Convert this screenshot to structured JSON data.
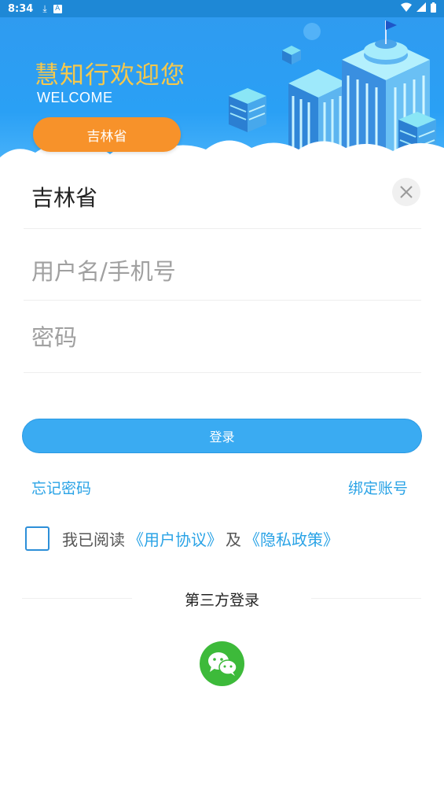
{
  "status_bar": {
    "time": "8:34",
    "icons": [
      "download-icon",
      "a-icon",
      "wifi-icon",
      "signal-icon",
      "battery-icon"
    ]
  },
  "header": {
    "title": "慧知行欢迎您",
    "subtitle": "WELCOME",
    "province_button": "吉林省"
  },
  "province_selector": {
    "selected": "吉林省",
    "close_icon": "close-icon"
  },
  "form": {
    "username_placeholder": "用户名/手机号",
    "username_value": "",
    "password_placeholder": "密码",
    "password_value": ""
  },
  "actions": {
    "login_label": "登录",
    "forgot_password": "忘记密码",
    "bind_account": "绑定账号"
  },
  "agreement": {
    "prefix": "我已阅读",
    "user_agreement": "《用户协议》",
    "conjunction": "及",
    "privacy_policy": "《隐私政策》",
    "checked": false
  },
  "third_party": {
    "title": "第三方登录",
    "providers": [
      "wechat-icon"
    ]
  },
  "colors": {
    "header_blue": "#2f9bf0",
    "title_yellow": "#f5c84c",
    "province_orange": "#f7922a",
    "login_blue": "#3aabf2",
    "link_blue": "#2aa3e6",
    "wechat_green": "#3dba3a"
  }
}
